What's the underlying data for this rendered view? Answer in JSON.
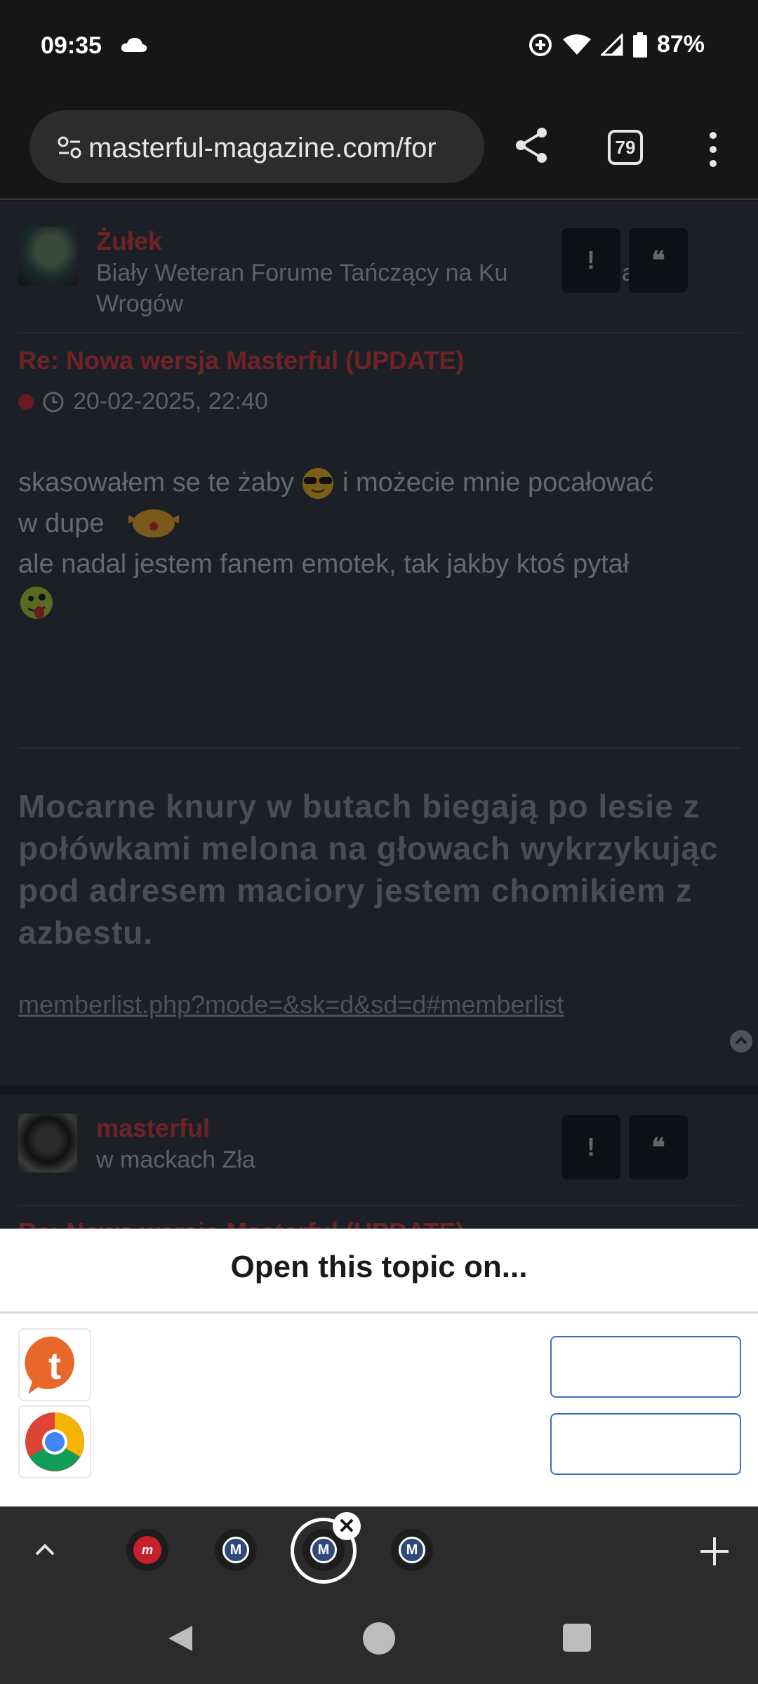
{
  "status_bar": {
    "time": "09:35",
    "battery": "87%"
  },
  "browser": {
    "url": "masterful-magazine.com/for",
    "tab_count": "79"
  },
  "posts": [
    {
      "author": "Żułek",
      "rank": "Biały Weteran Forume Tańczący na Ku",
      "rank_tail": "a",
      "rank_line2": "Wrogów",
      "title": "Re: Nowa wersja Masterful (UPDATE)",
      "date": "20-02-2025, 22:40",
      "text_line1a": "skasowałem se te żaby",
      "text_line1b": "i możecie mnie pocałować",
      "text_line2": "w dupe",
      "text_line3": "ale nadal jestem fanem emotek, tak jakby ktoś pytał",
      "signature": "Mocarne knury w butach biegają po lesie z połówkami melona na głowach wykrzykując pod adresem maciory jestem chomikiem z azbestu.",
      "signature_link": "memberlist.php?mode=&sk=d&sd=d#memberlist"
    },
    {
      "author": "masterful",
      "rank": "w mackach Zła",
      "title": "Re: Nowa wersja Masterful (UPDATE)"
    }
  ],
  "buttons": {
    "report": "!",
    "quote": "❝"
  },
  "sheet": {
    "title": "Open this topic on..."
  },
  "tabstrip": {
    "tab1": "m",
    "tab_m": "M"
  },
  "icons": {
    "cloud": "cloud-icon",
    "data_saver": "data-saver-icon",
    "wifi": "wifi-icon",
    "signal": "signal-icon",
    "battery": "battery-icon",
    "page_info": "page-info-icon",
    "share": "share-icon",
    "menu": "more-vert-icon",
    "clock": "clock-icon",
    "scroll_top": "chevron-up-icon",
    "tapatalk": "tapatalk-icon",
    "chrome": "chrome-icon",
    "expand": "chevron-up-icon",
    "close": "close-icon",
    "new_tab": "plus-icon",
    "back": "back-icon",
    "home": "home-icon",
    "recents": "recents-icon"
  },
  "colors": {
    "author_red": "#6e2426",
    "sheet_button_border": "#3a6fc4",
    "favicon_blue": "#2d4a7a",
    "favicon_red": "#c8202a"
  }
}
